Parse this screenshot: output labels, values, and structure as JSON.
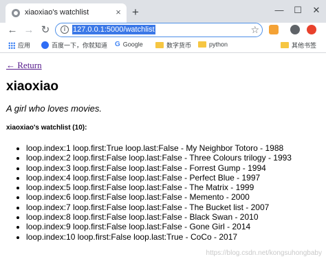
{
  "browser": {
    "tab": {
      "title": "xiaoxiao's watchlist",
      "close": "×"
    },
    "new_tab": "+",
    "window_controls": {
      "minimize": "—",
      "maximize": "☐",
      "close": "✕"
    },
    "address_bar": {
      "url": "127.0.0.1:5000/watchlist"
    },
    "bookmarks": [
      {
        "label": "应用",
        "icon": "apps-icon"
      },
      {
        "label": "百度一下，你就知道",
        "icon": "baidu-icon"
      },
      {
        "label": "Google",
        "icon": "google-icon"
      },
      {
        "label": "数字货币",
        "icon": "folder-icon"
      },
      {
        "label": "python",
        "icon": "folder-icon"
      },
      {
        "label": "其他书签",
        "icon": "folder-icon"
      }
    ],
    "colors": {
      "accent": "#4d8fe8",
      "selection": "#3b78e7"
    }
  },
  "page": {
    "return_link": "← Return",
    "title": "xiaoxiao",
    "tagline": "A girl who loves movies.",
    "list_heading": "xiaoxiao's watchlist (10):",
    "movies": [
      "loop.index:1 loop.first:True loop.last:False - My Neighbor Totoro - 1988",
      "loop.index:2 loop.first:False loop.last:False - Three Colours trilogy - 1993",
      "loop.index:3 loop.first:False loop.last:False - Forrest Gump - 1994",
      "loop.index:4 loop.first:False loop.last:False - Perfect Blue - 1997",
      "loop.index:5 loop.first:False loop.last:False - The Matrix - 1999",
      "loop.index:6 loop.first:False loop.last:False - Memento - 2000",
      "loop.index:7 loop.first:False loop.last:False - The Bucket list - 2007",
      "loop.index:8 loop.first:False loop.last:False - Black Swan - 2010",
      "loop.index:9 loop.first:False loop.last:False - Gone Girl - 2014",
      "loop.index:10 loop.first:False loop.last:True - CoCo - 2017"
    ],
    "watermark": "https://blog.csdn.net/kongsuhongbaby"
  }
}
